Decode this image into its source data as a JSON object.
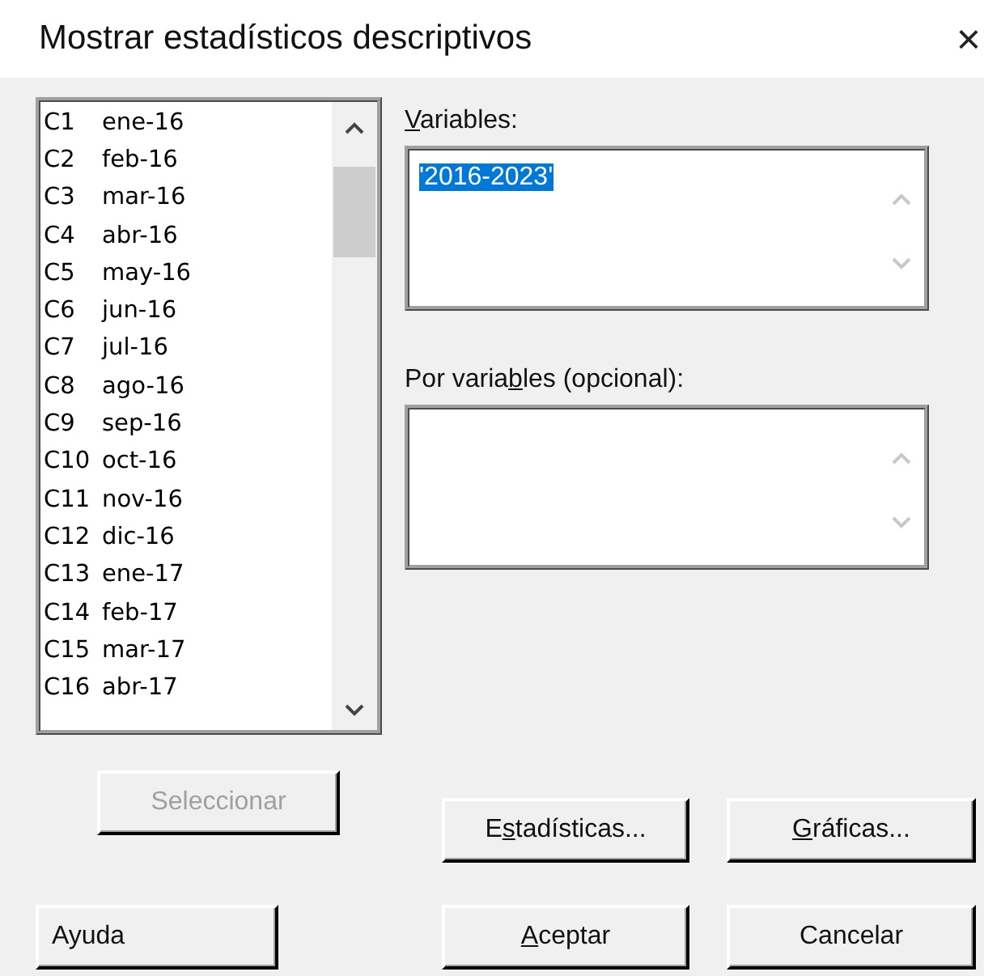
{
  "window": {
    "title": "Mostrar estadísticos descriptivos",
    "close": "×"
  },
  "columns_list": [
    {
      "id": "C1",
      "name": "ene-16"
    },
    {
      "id": "C2",
      "name": "feb-16"
    },
    {
      "id": "C3",
      "name": "mar-16"
    },
    {
      "id": "C4",
      "name": "abr-16"
    },
    {
      "id": "C5",
      "name": "may-16"
    },
    {
      "id": "C6",
      "name": "jun-16"
    },
    {
      "id": "C7",
      "name": "jul-16"
    },
    {
      "id": "C8",
      "name": "ago-16"
    },
    {
      "id": "C9",
      "name": "sep-16"
    },
    {
      "id": "C10",
      "name": "oct-16"
    },
    {
      "id": "C11",
      "name": "nov-16"
    },
    {
      "id": "C12",
      "name": "dic-16"
    },
    {
      "id": "C13",
      "name": "ene-17"
    },
    {
      "id": "C14",
      "name": "feb-17"
    },
    {
      "id": "C15",
      "name": "mar-17"
    },
    {
      "id": "C16",
      "name": "abr-17"
    }
  ],
  "variables": {
    "label": {
      "key": "V",
      "after": "ariables:"
    },
    "value": "'2016-2023'",
    "highlighted": true
  },
  "by_variables": {
    "label": {
      "before": "Por varia",
      "key": "b",
      "after": "les (opcional):"
    }
  },
  "buttons": [
    {
      "label": {
        "before": "Seleccionar"
      },
      "disabled": true
    },
    {
      "label": {
        "before": "E",
        "key": "s",
        "after": "tadísticas..."
      },
      "disabled": false
    },
    {
      "label": {
        "key": "G",
        "after": "ráficas..."
      },
      "disabled": false
    },
    {
      "label": {
        "before": "Ayuda"
      },
      "disabled": false
    },
    {
      "label": {
        "key": "A",
        "after": "ceptar"
      },
      "disabled": false
    },
    {
      "label": {
        "before": "Cancelar"
      },
      "disabled": false
    }
  ]
}
